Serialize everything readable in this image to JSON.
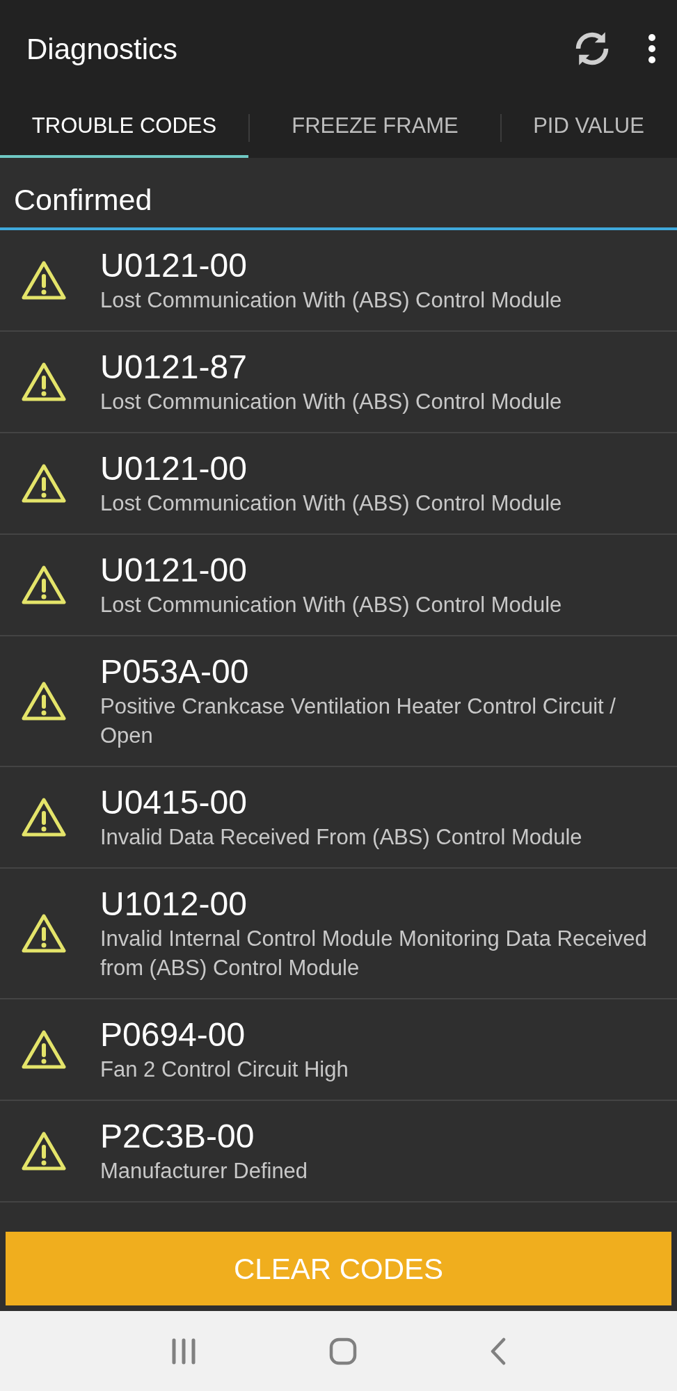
{
  "app_bar": {
    "title": "Diagnostics"
  },
  "tabs": [
    {
      "label": "TROUBLE CODES",
      "selected": true
    },
    {
      "label": "FREEZE FRAME",
      "selected": false
    },
    {
      "label": "PID VALUE",
      "selected": false
    }
  ],
  "section": {
    "title": "Confirmed"
  },
  "codes": [
    {
      "code": "U0121-00",
      "description": "Lost Communication With (ABS) Control Module"
    },
    {
      "code": "U0121-87",
      "description": "Lost Communication With (ABS) Control Module"
    },
    {
      "code": "U0121-00",
      "description": "Lost Communication With (ABS) Control Module"
    },
    {
      "code": "U0121-00",
      "description": "Lost Communication With (ABS) Control Module"
    },
    {
      "code": "P053A-00",
      "description": "Positive Crankcase Ventilation Heater Control Circuit / Open"
    },
    {
      "code": "U0415-00",
      "description": "Invalid Data Received From (ABS) Control Module"
    },
    {
      "code": "U1012-00",
      "description": "Invalid Internal Control Module Monitoring Data Received from (ABS) Control Module"
    },
    {
      "code": "P0694-00",
      "description": "Fan 2 Control Circuit High"
    },
    {
      "code": "P2C3B-00",
      "description": "Manufacturer Defined"
    }
  ],
  "action_button": {
    "label": "CLEAR CODES"
  }
}
